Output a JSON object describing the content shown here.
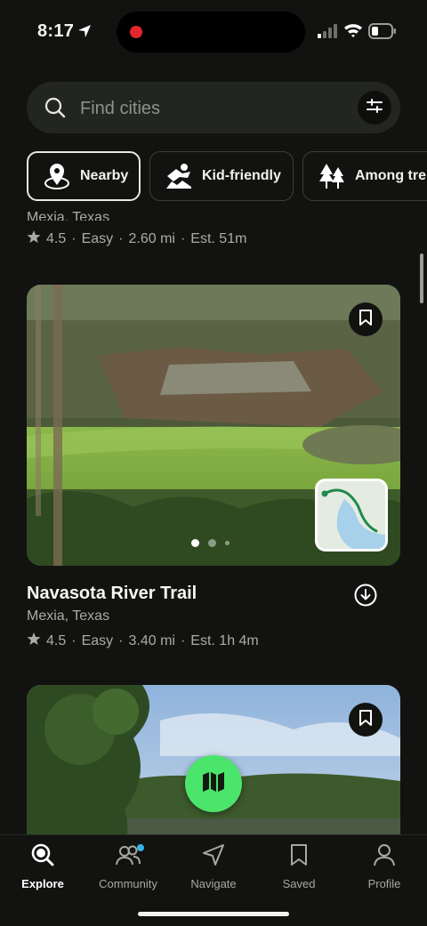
{
  "status_bar": {
    "time": "8:17",
    "recording_color": "#e5262d"
  },
  "search": {
    "placeholder": "Find cities",
    "icon": "search-icon",
    "filter_icon": "sliders-icon"
  },
  "chips": [
    {
      "label": "Nearby",
      "icon": "location-pin-icon",
      "active": true
    },
    {
      "label": "Kid-friendly",
      "icon": "kids-icon",
      "active": false
    },
    {
      "label": "Among tre",
      "icon": "trees-icon",
      "active": false
    }
  ],
  "previous_card": {
    "location_cut": "Mexia, Texas",
    "rating": "4.5",
    "difficulty": "Easy",
    "distance": "2.60 mi",
    "est": "Est. 51m"
  },
  "trail_card": {
    "title": "Navasota River Trail",
    "location": "Mexia, Texas",
    "rating": "4.5",
    "difficulty": "Easy",
    "distance": "3.40 mi",
    "est": "Est. 1h 4m",
    "image_pages": 3,
    "current_page": 1
  },
  "colors": {
    "accent_green": "#4ce56b",
    "background": "#121310",
    "badge_blue": "#35b3e8"
  },
  "tabs": [
    {
      "label": "Explore",
      "icon": "explore-search-icon",
      "active": true
    },
    {
      "label": "Community",
      "icon": "community-icon",
      "active": false
    },
    {
      "label": "Navigate",
      "icon": "navigate-arrow-icon",
      "active": false
    },
    {
      "label": "Saved",
      "icon": "bookmark-icon",
      "active": false
    },
    {
      "label": "Profile",
      "icon": "person-icon",
      "active": false
    }
  ],
  "separator": "·"
}
